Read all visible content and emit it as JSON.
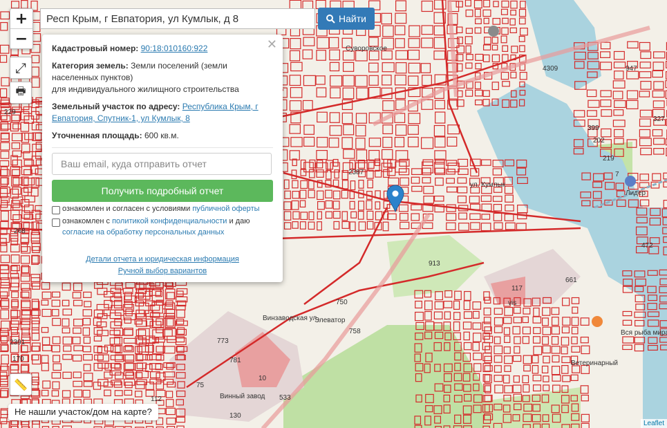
{
  "search": {
    "value": "Респ Крым, г Евпатория, ул Кумлык, д 8",
    "button_label": "Найти"
  },
  "controls": {
    "zoom_in": "+",
    "zoom_out": "−"
  },
  "popup": {
    "cadastral_label": "Кадастровый номер:",
    "cadastral_value": "90:18:010160:922",
    "category_label": "Категория земель:",
    "category_value_1": "Земли поселений (земли",
    "category_value_2": "населенных пунктов)",
    "category_value_3": "для индивидуального жилищного строительства",
    "address_label": "Земельный участок по адресу:",
    "address_value_1": "Республика Крым, г",
    "address_value_2": "Евпатория, Спутник-1, ул Кумлык, 8",
    "area_label": "Уточненная площадь:",
    "area_value": "600 кв.м.",
    "email_placeholder": "Ваш email, куда отправить отчет",
    "report_button": "Получить подробный отчет",
    "agree1_prefix": "ознакомлен и согласен с условиями",
    "agree1_link": "публичной оферты",
    "agree2_prefix": "ознакомлен с",
    "agree2_link": "политикой конфиденциальности",
    "agree2_mid": "и даю",
    "agree2_link2": "согласие на обработку персональных данных",
    "details_link": "Детали отчета и юридическая информация",
    "manual_link": "Ручной выбор вариантов"
  },
  "not_found_button": "Не нашли участок/дом на карте?",
  "attribution": "Leaflet",
  "map_labels": [
    {
      "t": "4309"
    },
    {
      "t": "947"
    },
    {
      "t": "327"
    },
    {
      "t": "399"
    },
    {
      "t": "202"
    },
    {
      "t": "219"
    },
    {
      "t": "7"
    },
    {
      "t": "Лидер"
    },
    {
      "t": "2387"
    },
    {
      "t": "913"
    },
    {
      "t": "472"
    },
    {
      "t": "117"
    },
    {
      "t": "661"
    },
    {
      "t": "750"
    },
    {
      "t": "758"
    },
    {
      "t": "Элеватор"
    },
    {
      "t": "773"
    },
    {
      "t": "781"
    },
    {
      "t": "10"
    },
    {
      "t": "75"
    },
    {
      "t": "533"
    },
    {
      "t": "130"
    },
    {
      "t": "112"
    },
    {
      "t": "Винный завод"
    },
    {
      "t": "2391"
    },
    {
      "t": "170"
    },
    {
      "t": "268"
    },
    {
      "t": "229"
    },
    {
      "t": "Суворовское"
    },
    {
      "t": "Вся рыба мира"
    },
    {
      "t": "Ветеринарный"
    },
    {
      "t": "vis"
    },
    {
      "t": "Винзаводская ул."
    },
    {
      "t": "ул. Кумлык"
    }
  ],
  "colors": {
    "parcel": "#d42a2a",
    "search_button": "#337ab7",
    "report_button": "#5cb85c",
    "marker": "#2b82cb"
  }
}
